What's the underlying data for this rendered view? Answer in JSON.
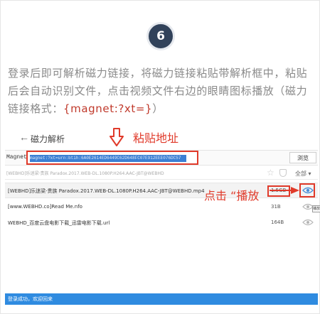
{
  "step": {
    "number": "6"
  },
  "instruction": {
    "text": "登录后即可解析磁力链接，将磁力链接粘贴带解析框中，粘贴后会自动识别文件，点击视频文件右边的眼睛图标播放（磁力链接格式：",
    "magnet_format": "{magnet:?xt=}",
    "closing": "）"
  },
  "nav": {
    "back_icon": "arrow-left-icon",
    "title": "磁力解析"
  },
  "annotations": {
    "paste_address": "粘贴地址",
    "click_play": "点击 “播放",
    "accent_color": "#e03a2a"
  },
  "magnet": {
    "label": "Magnet:",
    "value": "magnet:?xt=urn:btih:6A0E2614ED6449C62D648FC07E912EEE076DC57",
    "browse_label": "浏览"
  },
  "torrent_info": {
    "title": "[WEBHD]乐迷梁·贵族 Paradox.2017.WEB-DL.1080P.H264.AAC-JBT@WEBHD",
    "select_all": "全部 ▾"
  },
  "files": [
    {
      "name": "[WEBHD]乐迷梁·贵族 Paradox.2017.WEB-DL.1080P.H264.AAC-JBT@WEBHD.mp4",
      "size": "1.5GB"
    },
    {
      "name": "[www.WEBHD.co]Read Me.nfo",
      "size": "31B"
    },
    {
      "name": "WEBHD_百度云盘电影下载_迅雷电影下载.url",
      "size": "164B"
    }
  ],
  "tooltip": {
    "text": "播放"
  },
  "status": {
    "text": "登录成功，欢迎回来"
  }
}
